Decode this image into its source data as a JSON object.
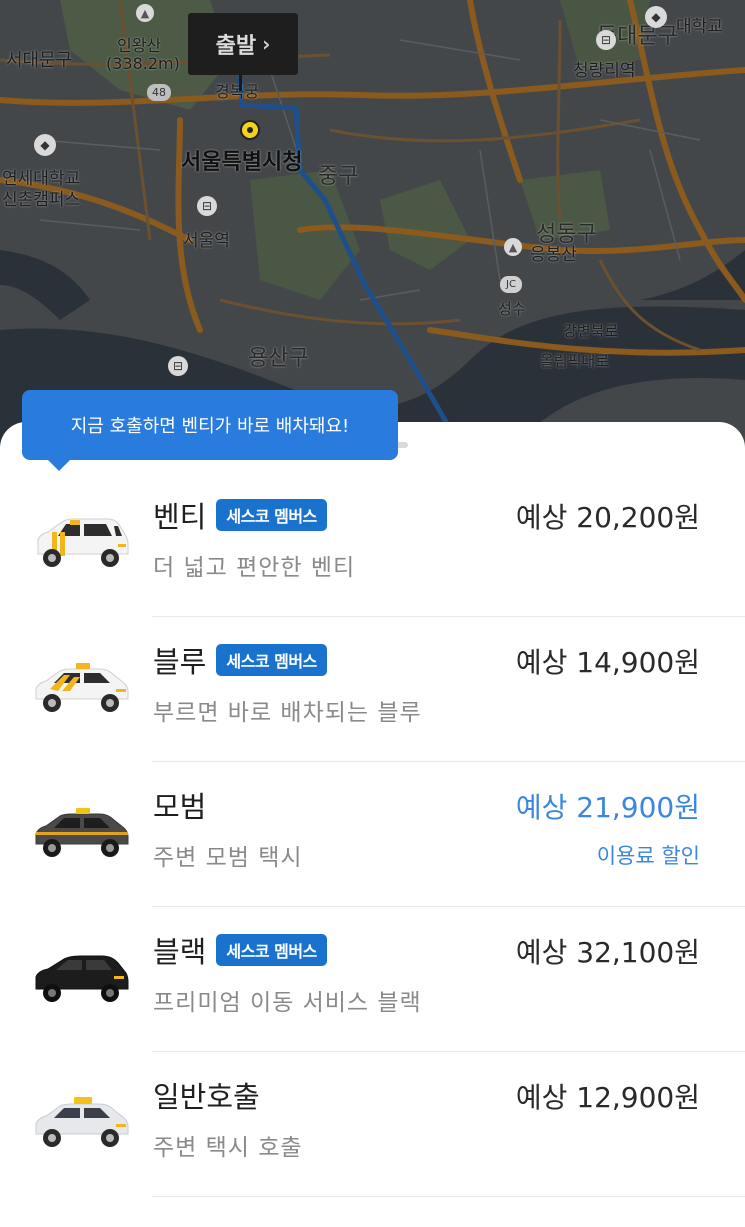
{
  "map": {
    "depart_label": "출발",
    "labels": {
      "inwangsan": "인왕산",
      "inwangsan_height": "(338.2m)",
      "seodaemungu": "서대문구",
      "gyeongbokgung": "경복궁",
      "city_hall": "서울특별시청",
      "junggu": "중구",
      "yonsei": "연세대학교",
      "sinchon": "신촌캠퍼스",
      "seoul_station": "서울역",
      "yongsangu": "용산구",
      "seongdonggu": "성동구",
      "eungbongsan": "응봉산",
      "seongsu": "성수",
      "jc": "JC",
      "cheongnyangni": "청량리역",
      "dongdaemungu": "동대문구",
      "univ": "대학교",
      "gangbyeon": "강변북로",
      "olympic": "올림픽대로",
      "route_48": "48"
    }
  },
  "tooltip": "지금 호출하면 벤티가 바로 배차돼요!",
  "rides": [
    {
      "name": "벤티",
      "badge": "세스코 멤버스",
      "desc": "더 넓고 편안한 벤티",
      "price": "예상 20,200원",
      "sub_price": ""
    },
    {
      "name": "블루",
      "badge": "세스코 멤버스",
      "desc": "부르면 바로 배차되는 블루",
      "price": "예상 14,900원",
      "sub_price": ""
    },
    {
      "name": "모범",
      "badge": "",
      "desc": "주변 모범 택시",
      "price": "예상 21,900원",
      "sub_price": "이용료 할인"
    },
    {
      "name": "블랙",
      "badge": "세스코 멤버스",
      "desc": "프리미엄 이동 서비스 블랙",
      "price": "예상 32,100원",
      "sub_price": ""
    },
    {
      "name": "일반호출",
      "badge": "",
      "desc": "주변 택시 호출",
      "price": "예상 12,900원",
      "sub_price": ""
    }
  ],
  "colors": {
    "accent": "#2a7bde",
    "badge": "#1a72cf",
    "price_highlight": "#3b87df",
    "route": "#1f4f8a"
  }
}
